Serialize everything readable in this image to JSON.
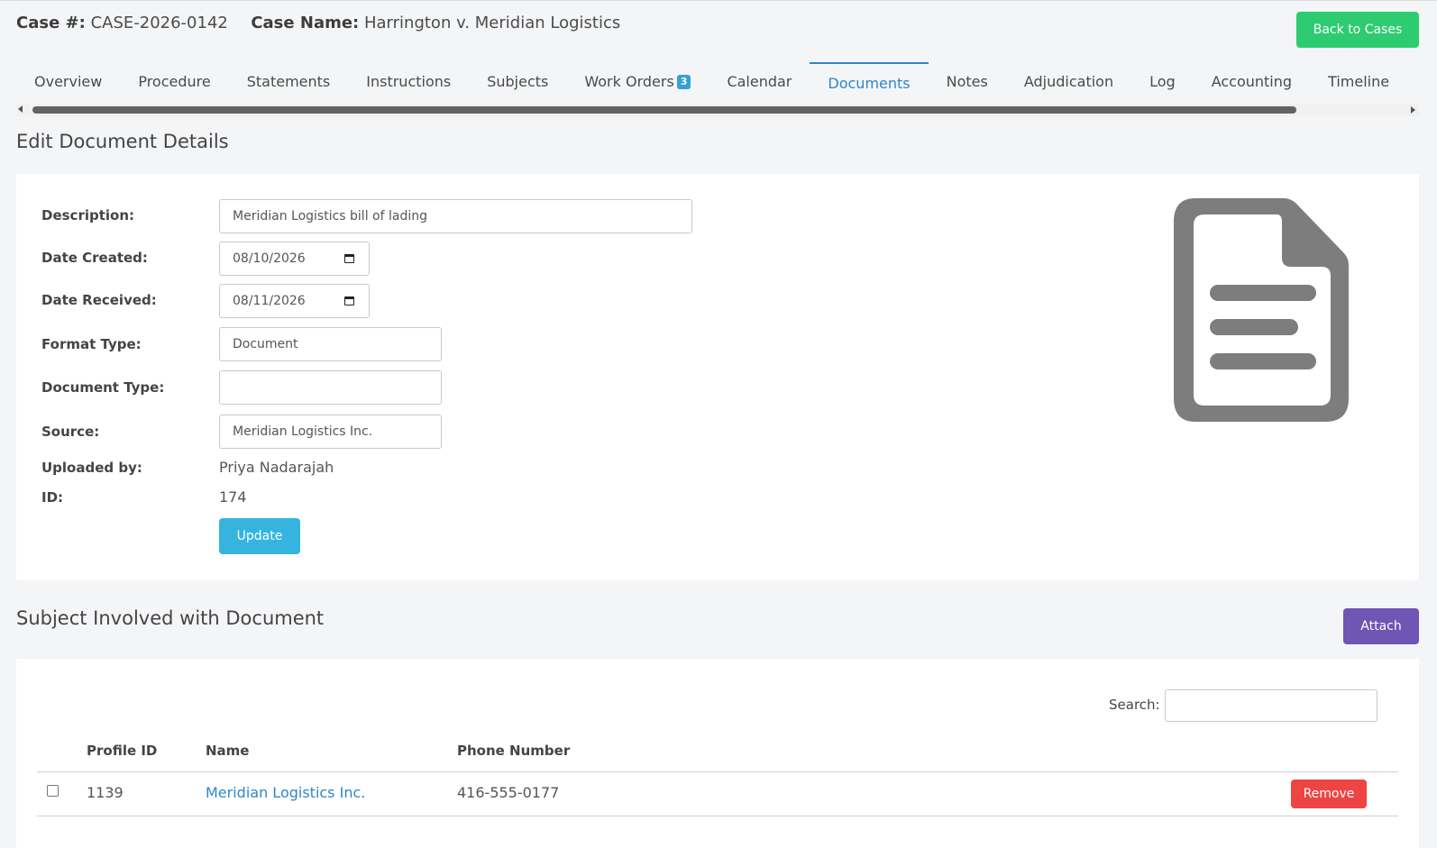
{
  "header": {
    "case_number_label": "Case #:",
    "case_number": "CASE-2026-0142",
    "case_name_label": "Case Name:",
    "case_name": "Harrington v. Meridian Logistics",
    "back_button": "Back to Cases"
  },
  "tabs": [
    {
      "label": "Overview"
    },
    {
      "label": "Procedure"
    },
    {
      "label": "Statements"
    },
    {
      "label": "Instructions"
    },
    {
      "label": "Subjects"
    },
    {
      "label": "Work Orders",
      "badge": "3"
    },
    {
      "label": "Calendar"
    },
    {
      "label": "Documents",
      "active": true
    },
    {
      "label": "Notes"
    },
    {
      "label": "Adjudication"
    },
    {
      "label": "Log"
    },
    {
      "label": "Accounting"
    },
    {
      "label": "Timeline"
    }
  ],
  "edit_section": {
    "title": "Edit Document Details",
    "fields": {
      "description": {
        "label": "Description:",
        "value": "Meridian Logistics bill of lading"
      },
      "date_created": {
        "label": "Date Created:",
        "value": "08/10/2026"
      },
      "date_received": {
        "label": "Date Received:",
        "value": "08/11/2026"
      },
      "format_type": {
        "label": "Format Type:",
        "value": "Document"
      },
      "document_type": {
        "label": "Document Type:",
        "value": ""
      },
      "source": {
        "label": "Source:",
        "value": "Meridian Logistics Inc."
      },
      "uploaded_by": {
        "label": "Uploaded by:",
        "value": "Priya Nadarajah"
      },
      "id": {
        "label": "ID:",
        "value": "174"
      }
    },
    "update_button": "Update",
    "icon": "file-document-icon"
  },
  "subjects_section": {
    "title": "Subject Involved with Document",
    "attach_button": "Attach",
    "search_label": "Search:",
    "columns": [
      "Profile ID",
      "Name",
      "Phone Number"
    ],
    "rows": [
      {
        "profile_id": "1139",
        "name": "Meridian Logistics Inc.",
        "phone": "416-555-0177",
        "remove_label": "Remove"
      }
    ]
  },
  "colors": {
    "accent": "#2e86c9",
    "back_button": "#2ecc71",
    "update_button": "#35b4e0",
    "attach_button": "#6f56b4",
    "remove_button": "#ee4444"
  }
}
